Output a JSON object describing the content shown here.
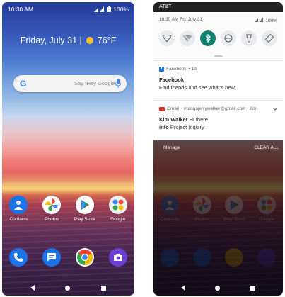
{
  "home": {
    "status": {
      "time": "10:30 AM",
      "battery": "100%"
    },
    "date_weather": "Friday, July 31 |",
    "temperature": "76°F",
    "search": {
      "placeholder": "Say \"Hey Google\""
    },
    "apps": [
      "Contacts",
      "Photos",
      "Play Store",
      "Google"
    ],
    "dock": [
      "phone-icon",
      "messages-icon",
      "chrome-icon",
      "camera-icon"
    ]
  },
  "shade": {
    "carrier": "AT&T",
    "time_date": "10:30 AM Fri, July 31",
    "battery": "100%",
    "tiles": [
      "wifi-icon",
      "wifi-off-icon",
      "bluetooth-icon",
      "dnd-icon",
      "flashlight-icon",
      "rotate-icon"
    ],
    "notifications": [
      {
        "app": "Facebook",
        "meta": "• 1d",
        "title": "Facebook",
        "body": "Find friends and see what's new."
      },
      {
        "app": "Gmail",
        "meta": "• mangojerrywalker@gmail.com • 6m",
        "sender": "Kim Walker",
        "sender_text": "Hi there",
        "label": "info",
        "subject": "Project Inquiry"
      }
    ],
    "manage": "Manage",
    "clear_all": "CLEAR ALL"
  },
  "colors": {
    "accent": "#0f7f6e",
    "facebook": "#1877f2",
    "gmail": "#d93025"
  }
}
